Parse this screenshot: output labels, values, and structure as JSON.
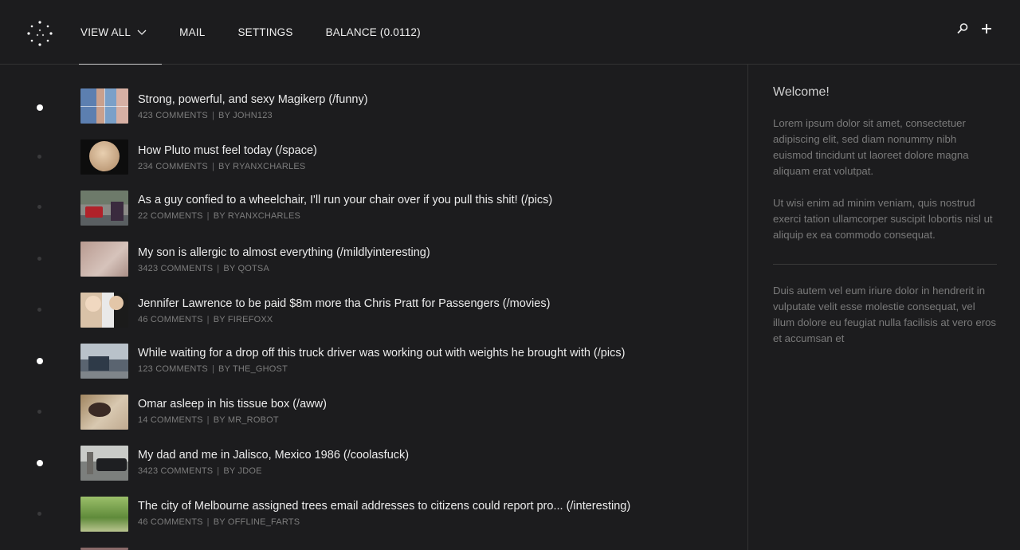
{
  "nav": {
    "items": [
      {
        "label": "VIEW ALL",
        "active": true
      },
      {
        "label": "MAIL"
      },
      {
        "label": "SETTINGS"
      },
      {
        "label": "BALANCE (0.0112)"
      }
    ],
    "icons": [
      "search-icon",
      "plus-icon",
      "chevron-down-icon",
      "logo-dots-icon"
    ]
  },
  "posts": [
    {
      "title": "Strong, powerful, and sexy Magikerp (/funny)",
      "comments": "423 COMMENTS",
      "by": "BY JOHN123",
      "unread": true
    },
    {
      "title": "How Pluto must feel today (/space)",
      "comments": "234 COMMENTS",
      "by": "BY RYANXCHARLES",
      "unread": false
    },
    {
      "title": "As a guy confied to a wheelchair, I'll run your chair over if you pull this shit! (/pics)",
      "comments": "22 COMMENTS",
      "by": "BY RYANXCHARLES",
      "unread": false
    },
    {
      "title": "My son is allergic to almost everything (/mildlyinteresting)",
      "comments": "3423 COMMENTS",
      "by": "BY QOTSA",
      "unread": false
    },
    {
      "title": "Jennifer Lawrence to be paid $8m more tha Chris Pratt for Passengers (/movies)",
      "comments": "46 COMMENTS",
      "by": "BY FIREFOXX",
      "unread": false
    },
    {
      "title": "While waiting for a drop off this truck driver was working out with weights he brought with  (/pics)",
      "comments": "123 COMMENTS",
      "by": "BY THE_GHOST",
      "unread": true
    },
    {
      "title": "Omar asleep in his tissue box (/aww)",
      "comments": "14 COMMENTS",
      "by": "BY MR_ROBOT",
      "unread": false
    },
    {
      "title": "My dad and me in Jalisco, Mexico 1986 (/coolasfuck)",
      "comments": "3423 COMMENTS",
      "by": "BY JDOE",
      "unread": true
    },
    {
      "title": "The city of Melbourne assigned trees email addresses to citizens could report pro... (/interesting)",
      "comments": "46 COMMENTS",
      "by": "BY OFFLINE_FARTS",
      "unread": false
    }
  ],
  "sidebar": {
    "title": "Welcome!",
    "p1": "Lorem ipsum dolor sit amet, consectetuer adipiscing elit, sed diam nonummy nibh euismod tincidunt ut laoreet dolore magna aliquam erat volutpat.",
    "p2": "Ut wisi enim ad minim veniam, quis nostrud exerci tation ullamcorper suscipit lobortis nisl ut aliquip ex ea commodo consequat.",
    "p3": "Duis autem vel eum iriure dolor in hendrerit in vulputate velit esse molestie consequat, vel illum dolore eu feugiat nulla facilisis at vero eros et accumsan et"
  },
  "colors": {
    "background": "#1c1c1e",
    "text": "#ececec",
    "meta": "#7d7d7d",
    "divider": "#333333"
  }
}
